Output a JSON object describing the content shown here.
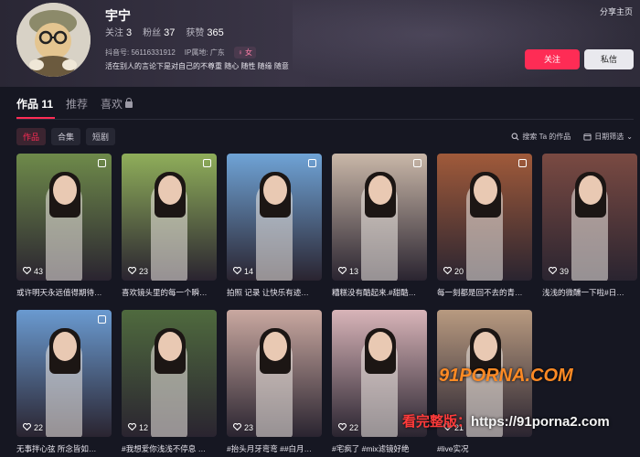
{
  "profile": {
    "name": "宇宁",
    "stats": [
      {
        "label": "关注",
        "value": "3"
      },
      {
        "label": "粉丝",
        "value": "37"
      },
      {
        "label": "获赞",
        "value": "365"
      }
    ],
    "douyin_id": "抖音号: 56116331912",
    "ip_location": "IP属地: 广东",
    "gender": "女",
    "bio": "活在别人的言论下是对自己的不尊重 随心 随性 随缘 随意",
    "share_label": "分享主页",
    "follow_label": "关注",
    "message_label": "私信"
  },
  "tabs": [
    {
      "label": "作品 11",
      "active": true
    },
    {
      "label": "推荐",
      "active": false
    },
    {
      "label": "喜欢",
      "active": false,
      "locked": true
    }
  ],
  "subtabs": [
    {
      "label": "作品",
      "active": true
    },
    {
      "label": "合集",
      "active": false
    },
    {
      "label": "短剧",
      "active": false
    }
  ],
  "tools": {
    "search_label": "搜索 Ta 的作品",
    "filter_label": "日期筛选"
  },
  "videos": [
    {
      "likes": "43",
      "caption": "或许明天永远值得期待…",
      "multi": true,
      "bg": "#6e8a4a"
    },
    {
      "likes": "23",
      "caption": "喜欢镜头里的每一个瞬…",
      "multi": true,
      "bg": "#8fae5a"
    },
    {
      "likes": "14",
      "caption": "拍照 记录 让快乐有迹…",
      "multi": true,
      "bg": "#6fa3d6"
    },
    {
      "likes": "13",
      "caption": "糟糕没有酷起来.#甜酷…",
      "multi": true,
      "bg": "#c9b7a8"
    },
    {
      "likes": "20",
      "caption": "每一刻都是回不去的青…",
      "multi": true,
      "bg": "#a05a3a"
    },
    {
      "likes": "39",
      "caption": "浅浅的微醺一下啦#日…",
      "multi": false,
      "bg": "#7a4a42"
    },
    {
      "likes": "22",
      "caption": "无事拌心弦 所念皆如…",
      "multi": true,
      "bg": "#6a9ad0"
    },
    {
      "likes": "12",
      "caption": "#我想爱你浅浅不停息 …",
      "multi": false,
      "bg": "#4f6a3e"
    },
    {
      "likes": "23",
      "caption": "#抬头月牙弯弯 ##白月…",
      "multi": false,
      "bg": "#c9a8a0"
    },
    {
      "likes": "22",
      "caption": "#宅疯了 #mix滤镜好绝",
      "multi": false,
      "bg": "#d8b4b8"
    },
    {
      "likes": "21",
      "caption": "#live实况",
      "multi": false,
      "bg": "#b89a80"
    }
  ],
  "watermark": {
    "line1": "91PORNA.COM",
    "line2_prefix": "看完整版：",
    "line2_url": "https://91porna2.com"
  },
  "colors": {
    "accent": "#fe2c55",
    "background": "#161722"
  }
}
